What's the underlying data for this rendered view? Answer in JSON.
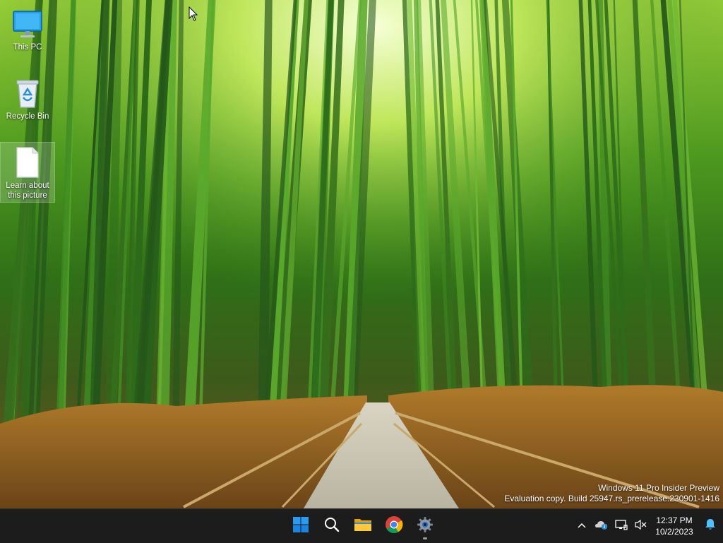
{
  "desktop": {
    "icons": [
      {
        "label": "This PC",
        "icon": "monitor-icon"
      },
      {
        "label": "Recycle Bin",
        "icon": "recycle-bin-icon"
      },
      {
        "label": "Learn about this picture",
        "icon": "document-icon"
      }
    ],
    "watermark": {
      "line1": "Windows 11 Pro Insider Preview",
      "line2": "Evaluation copy. Build 25947.rs_prerelease.230901-1416"
    }
  },
  "taskbar": {
    "apps": [
      {
        "name": "Start",
        "icon": "windows-logo-icon"
      },
      {
        "name": "Search",
        "icon": "search-icon"
      },
      {
        "name": "File Explorer",
        "icon": "folder-icon"
      },
      {
        "name": "Google Chrome",
        "icon": "chrome-icon"
      },
      {
        "name": "Settings",
        "icon": "gear-icon",
        "running": true
      }
    ],
    "tray": {
      "icons": [
        "chevron-up-icon",
        "onedrive-icon",
        "network-icon",
        "volume-muted-icon"
      ],
      "time": "12:37 PM",
      "date": "10/2/2023",
      "notification_icon": "bell-icon"
    }
  },
  "colors": {
    "taskbar_bg": "#1c1c1c",
    "windows_blue": "#0f7ddb",
    "folder_yellow": "#f2b600"
  }
}
